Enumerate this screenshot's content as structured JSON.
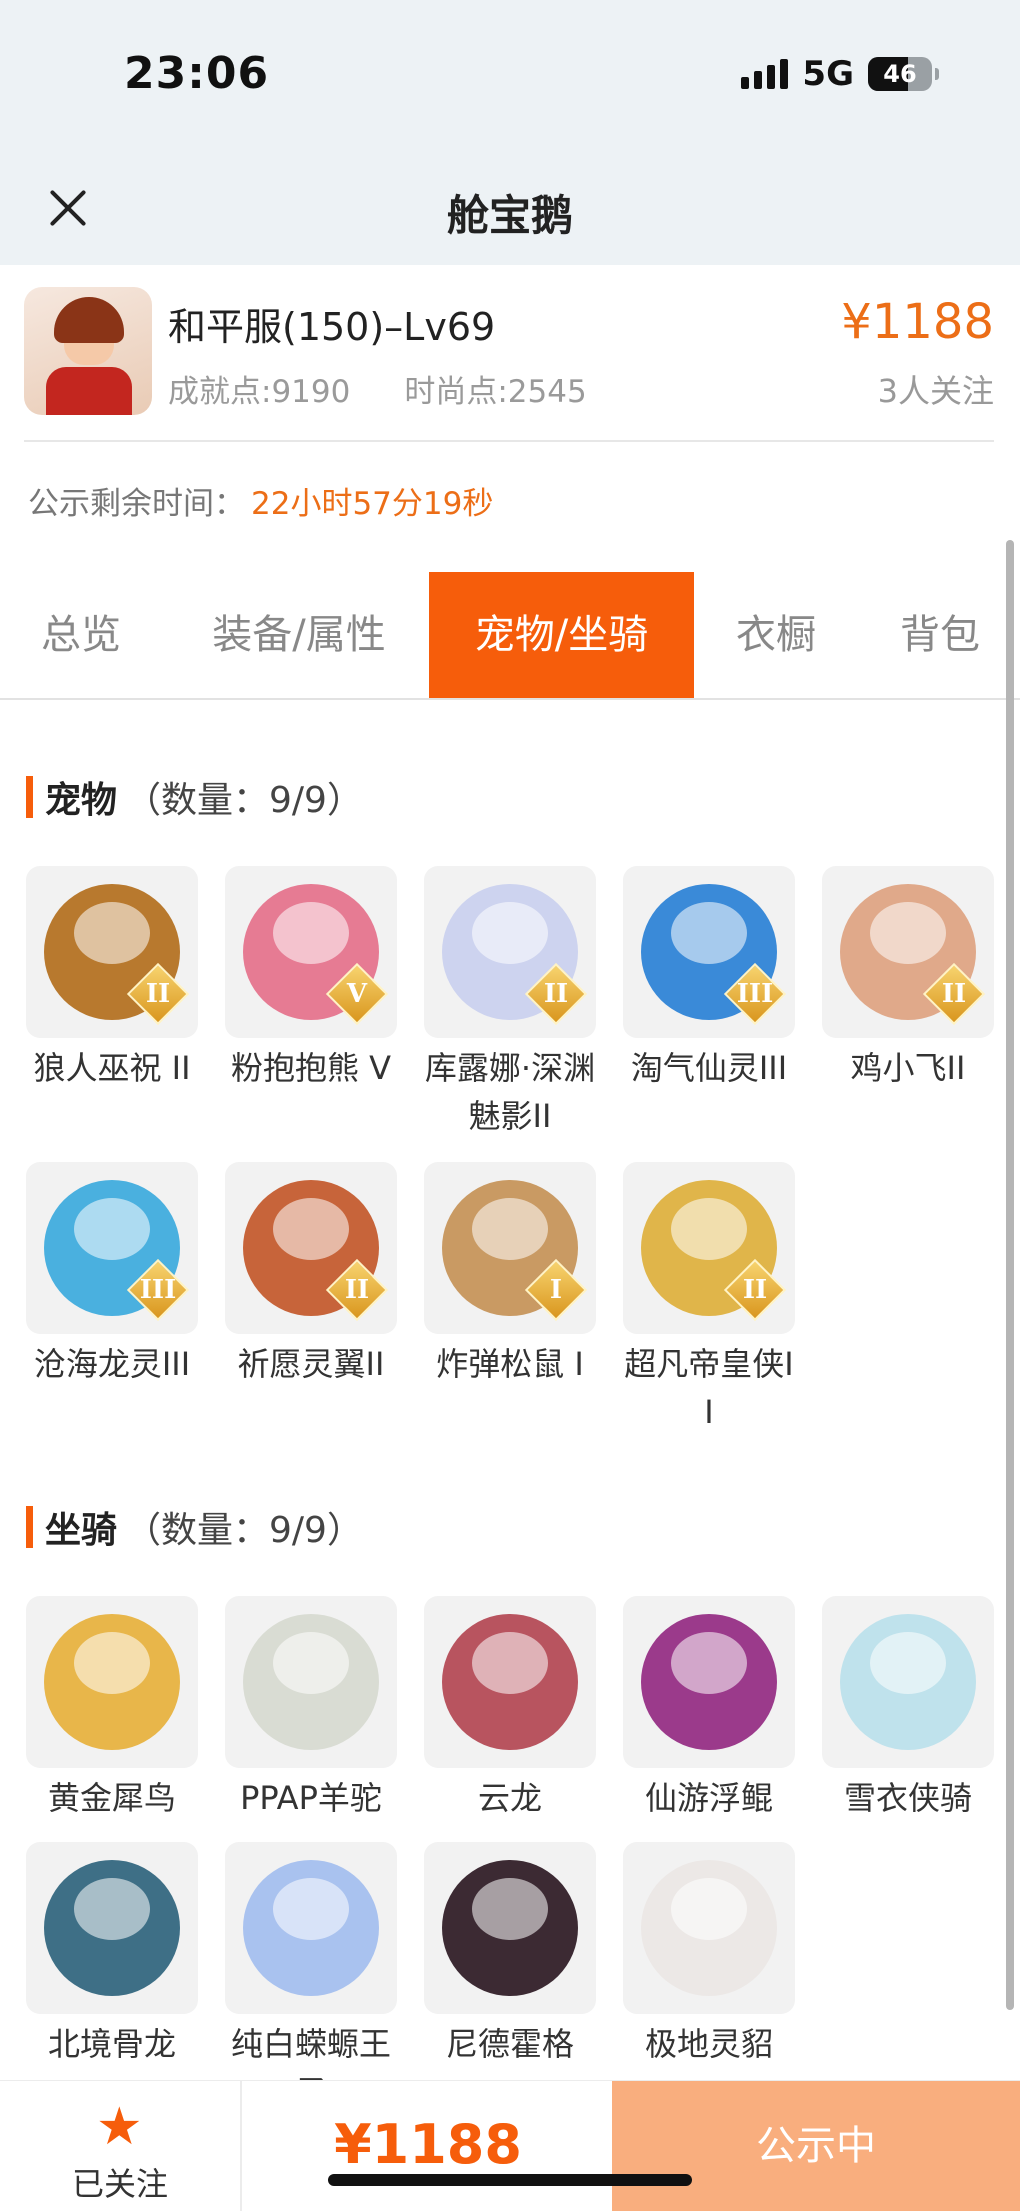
{
  "status_bar": {
    "time": "23:06",
    "network": "5G",
    "battery": "46"
  },
  "header": {
    "title": "舱宝鹅"
  },
  "info": {
    "server": "和平服(150)–Lv69",
    "price": "¥1188",
    "achievement": "成就点:9190",
    "fashion": "时尚点:2545",
    "followers": "3人关注",
    "countdown_label": "公示剩余时间：",
    "countdown_value": "22小时57分19秒"
  },
  "tabs": [
    "总览",
    "装备/属性",
    "宠物/坐骑",
    "衣橱",
    "背包"
  ],
  "active_tab": "宠物/坐骑",
  "pets": {
    "label": "宠物",
    "count": "（数量：9/9）",
    "items": [
      {
        "name": "狼人巫祝 II",
        "badge": "II",
        "color": "#b8792e"
      },
      {
        "name": "粉抱抱熊 V",
        "badge": "V",
        "color": "#e67b93"
      },
      {
        "name": "库露娜·深渊魅影II",
        "badge": "II",
        "color": "#cdd3ef"
      },
      {
        "name": "淘气仙灵III",
        "badge": "III",
        "color": "#3a8ad8"
      },
      {
        "name": "鸡小飞II",
        "badge": "II",
        "color": "#e0a98a"
      },
      {
        "name": "沧海龙灵III",
        "badge": "III",
        "color": "#4ab0df"
      },
      {
        "name": "祈愿灵翼II",
        "badge": "II",
        "color": "#c7643a"
      },
      {
        "name": "炸弹松鼠 I",
        "badge": "I",
        "color": "#c99a63"
      },
      {
        "name": "超凡帝皇侠II",
        "badge": "II",
        "color": "#e0b54a"
      }
    ]
  },
  "mounts": {
    "label": "坐骑",
    "count": "（数量：9/9）",
    "items": [
      {
        "name": "黄金犀鸟",
        "color": "#e8b64a"
      },
      {
        "name": "PPAP羊驼",
        "color": "#d9dcd3"
      },
      {
        "name": "云龙",
        "color": "#b8545f"
      },
      {
        "name": "仙游浮鲲",
        "color": "#9b3a8b"
      },
      {
        "name": "雪衣侠骑",
        "color": "#bfe2ec"
      },
      {
        "name": "北境骨龙",
        "color": "#3e6f86"
      },
      {
        "name": "纯白蝾螈王子",
        "color": "#a9c2ef"
      },
      {
        "name": "尼德霍格",
        "color": "#3c2a33"
      },
      {
        "name": "极地灵貂",
        "color": "#ece8e6"
      }
    ]
  },
  "bottom": {
    "follow_label": "已关注",
    "price": "¥1188",
    "status_label": "公示中"
  }
}
